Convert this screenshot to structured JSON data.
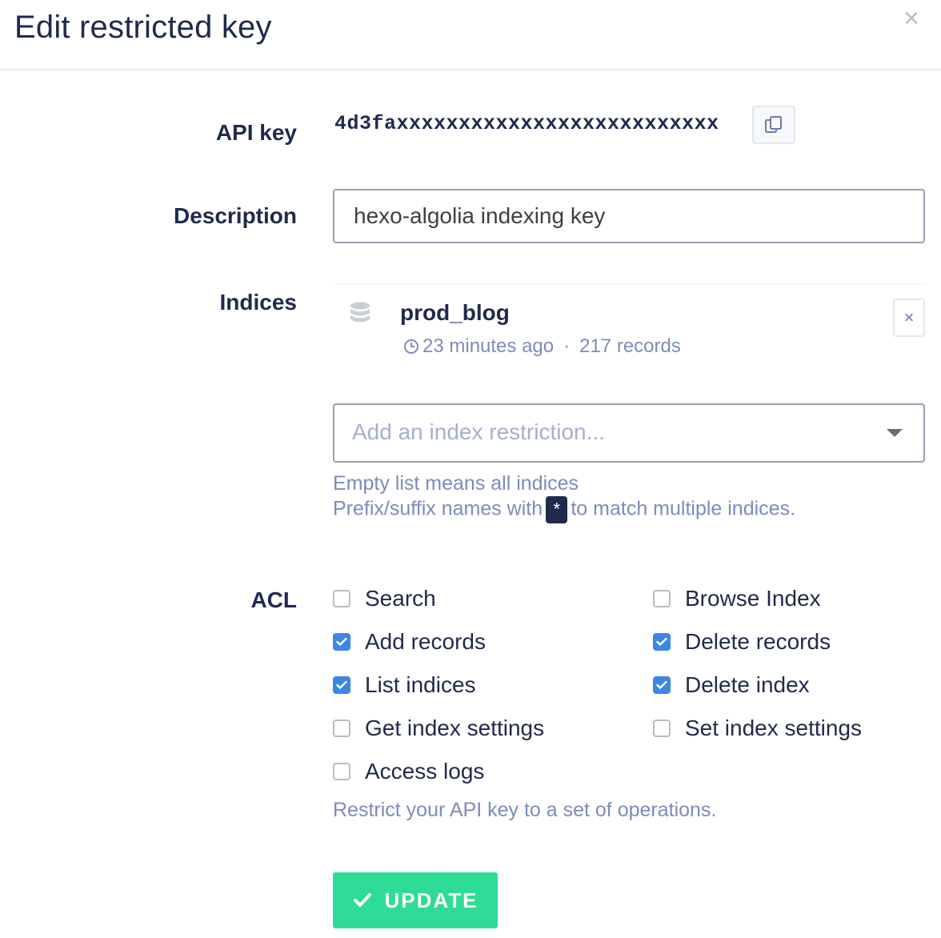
{
  "modal": {
    "title": "Edit restricted key",
    "close_label": "×"
  },
  "form": {
    "api_key": {
      "label": "API key",
      "value": "4d3faxxxxxxxxxxxxxxxxxxxxxxxxxx",
      "copy_icon": "copy-icon"
    },
    "description": {
      "label": "Description",
      "value": "hexo-algolia indexing key"
    },
    "indices": {
      "label": "Indices",
      "items": [
        {
          "name": "prod_blog",
          "updated": "23 minutes ago",
          "separator": "·",
          "records": "217 records",
          "icon": "database-icon",
          "remove_label": "×"
        }
      ],
      "select_placeholder": "Add an index restriction...",
      "help_line1": "Empty list means all indices",
      "help_line2_before": "Prefix/suffix names with",
      "help_kbd": "*",
      "help_line2_after": "to match multiple indices."
    },
    "acl": {
      "label": "ACL",
      "items": [
        {
          "label": "Search",
          "checked": false
        },
        {
          "label": "Browse Index",
          "checked": false
        },
        {
          "label": "Add records",
          "checked": true
        },
        {
          "label": "Delete records",
          "checked": true
        },
        {
          "label": "List indices",
          "checked": true
        },
        {
          "label": "Delete index",
          "checked": true
        },
        {
          "label": "Get index settings",
          "checked": false
        },
        {
          "label": "Set index settings",
          "checked": false
        },
        {
          "label": "Access logs",
          "checked": false
        }
      ],
      "help": "Restrict your API key to a set of operations."
    },
    "submit": {
      "label": "UPDATE",
      "icon": "check-icon"
    }
  },
  "colors": {
    "primary_text": "#1f2a4d",
    "muted_text": "#7d8bbd",
    "checkbox_checked": "#3b87e8",
    "update_button": "#2fdc95"
  }
}
